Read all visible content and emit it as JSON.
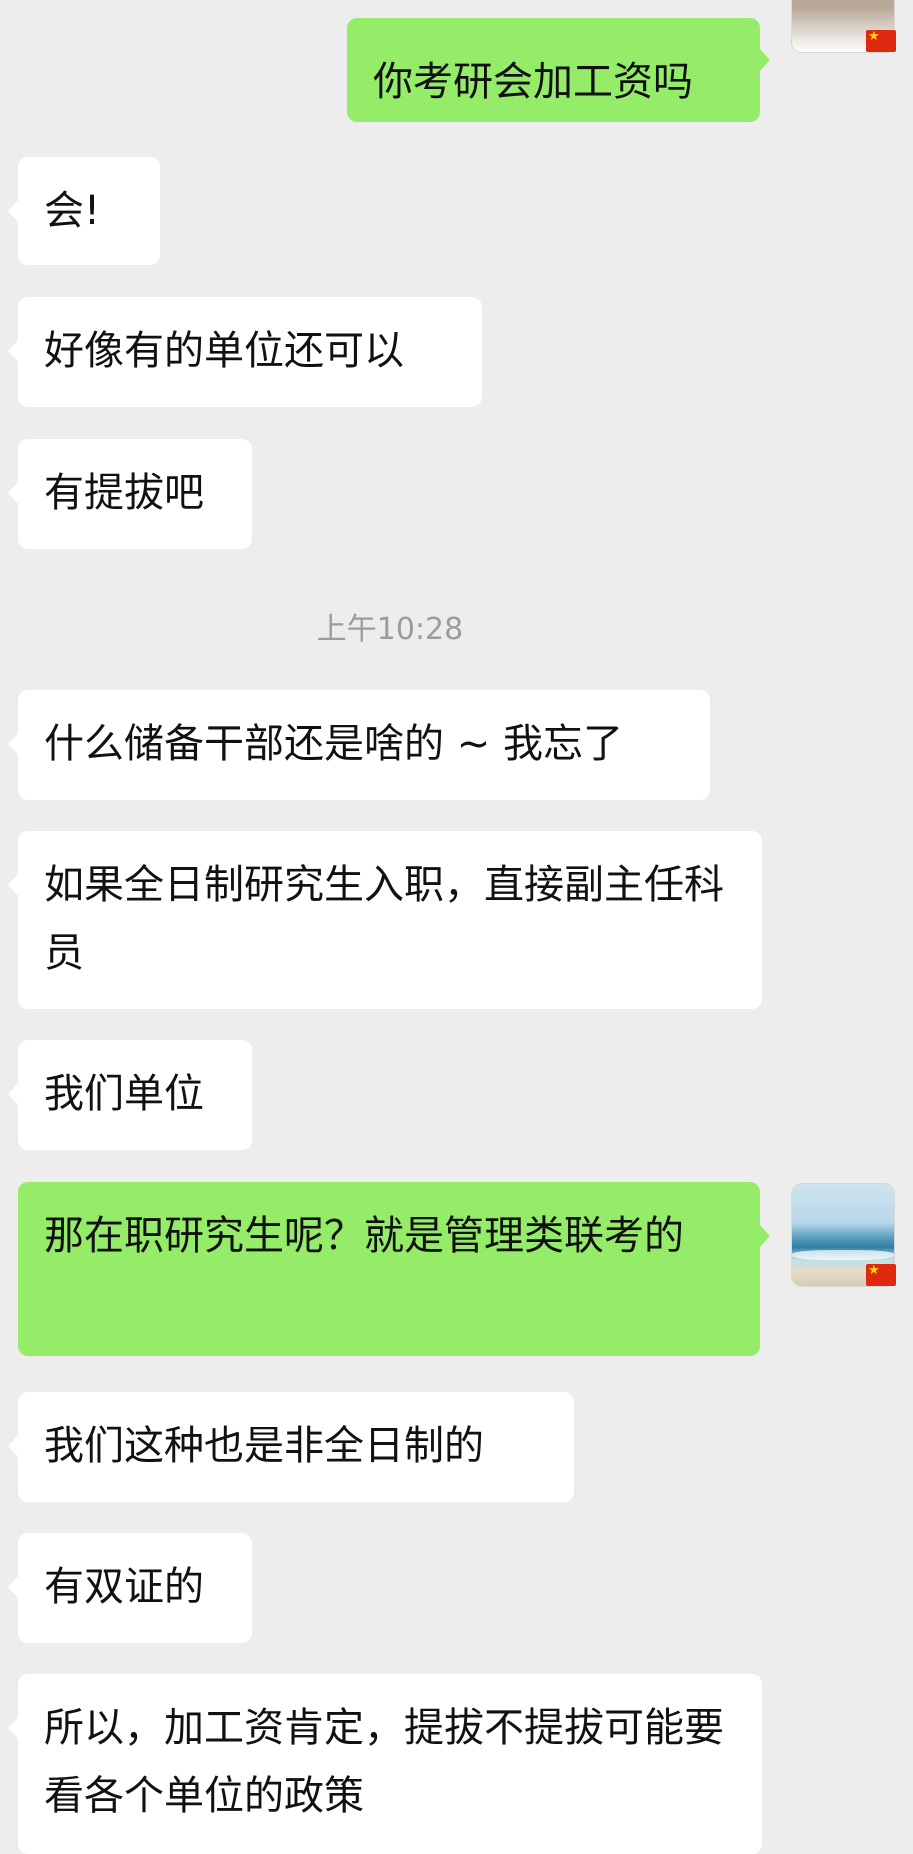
{
  "messages": [
    {
      "side": "out",
      "text": "你考研会加工资吗"
    },
    {
      "side": "in",
      "text": "会!"
    },
    {
      "side": "in",
      "text": "好像有的单位还可以"
    },
    {
      "side": "in",
      "text": "有提拔吧"
    },
    {
      "side": "in",
      "text": "什么储备干部还是啥的 ~ 我忘了"
    },
    {
      "side": "in",
      "text": "如果全日制研究生入职，直接副主任科员"
    },
    {
      "side": "in",
      "text": "我们单位"
    },
    {
      "side": "out",
      "text": "那在职研究生呢？就是管理类联考的"
    },
    {
      "side": "in",
      "text": "我们这种也是非全日制的"
    },
    {
      "side": "in",
      "text": "有双证的"
    },
    {
      "side": "in",
      "text": "所以，加工资肯定，提拔不提拔可能要看各个单位的政策"
    }
  ],
  "timestamp": "上午10:28",
  "icons": {
    "avatar": "beach-avatar-icon",
    "flag": "china-flag-icon"
  },
  "colors": {
    "background": "#ededed",
    "incoming_bubble": "#ffffff",
    "outgoing_bubble": "#95ec69",
    "timestamp_text": "#9c9c9c"
  }
}
